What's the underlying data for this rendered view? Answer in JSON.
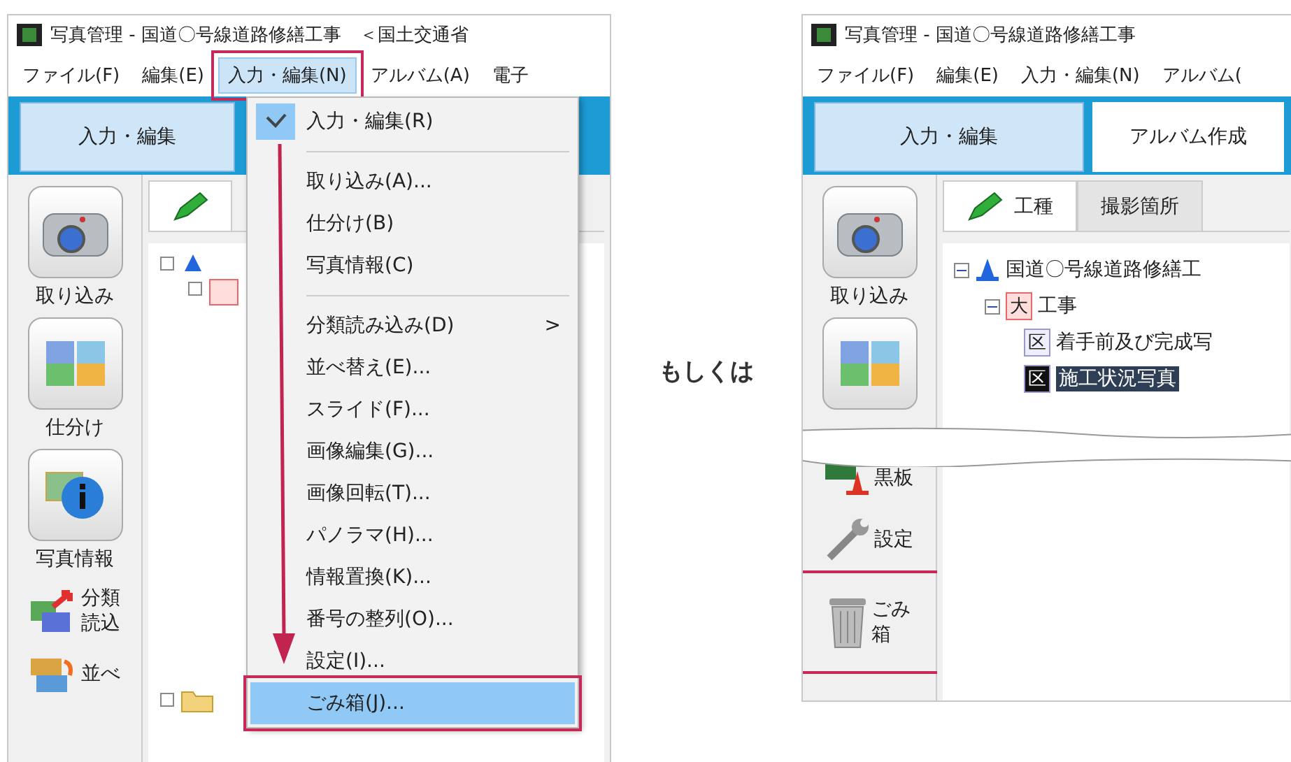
{
  "left_window": {
    "title": "写真管理 - 国道〇号線道路修繕工事　＜国土交通省",
    "menu": [
      {
        "label": "ファイル(F)",
        "selected": false,
        "annotated": false
      },
      {
        "label": "編集(E)",
        "selected": false,
        "annotated": false
      },
      {
        "label": "入力・編集(N)",
        "selected": true,
        "annotated": true
      },
      {
        "label": "アルバム(A)",
        "selected": false,
        "annotated": false
      },
      {
        "label": "電子",
        "selected": false,
        "annotated": false
      }
    ],
    "mode_tabs": [
      {
        "label": "入力・編集",
        "selected": true
      }
    ],
    "tools": [
      {
        "kind": "camera",
        "label": "取り込み"
      },
      {
        "kind": "sort",
        "label": "仕分け"
      },
      {
        "kind": "info",
        "label": "写真情報"
      },
      {
        "kind": "classify",
        "label": "分類読込"
      },
      {
        "kind": "reorder",
        "label": "並べ"
      }
    ],
    "dropdown": [
      {
        "kind": "item",
        "label": "入力・編集(R)",
        "checked": true,
        "selected": false,
        "annotated": false
      },
      {
        "kind": "separator"
      },
      {
        "kind": "item",
        "label": "取り込み(A)...",
        "checked": false,
        "selected": false,
        "annotated": false
      },
      {
        "kind": "item",
        "label": "仕分け(B)",
        "checked": false,
        "selected": false,
        "annotated": false
      },
      {
        "kind": "item",
        "label": "写真情報(C)",
        "checked": false,
        "selected": false,
        "annotated": false
      },
      {
        "kind": "separator"
      },
      {
        "kind": "submenu",
        "label": "分類読み込み(D)",
        "arrow": ">",
        "checked": false,
        "selected": false,
        "annotated": false
      },
      {
        "kind": "item",
        "label": "並べ替え(E)...",
        "checked": false,
        "selected": false,
        "annotated": false
      },
      {
        "kind": "item",
        "label": "スライド(F)...",
        "checked": false,
        "selected": false,
        "annotated": false
      },
      {
        "kind": "item",
        "label": "画像編集(G)...",
        "checked": false,
        "selected": false,
        "annotated": false
      },
      {
        "kind": "item",
        "label": "画像回転(T)...",
        "checked": false,
        "selected": false,
        "annotated": false
      },
      {
        "kind": "item",
        "label": "パノラマ(H)...",
        "checked": false,
        "selected": false,
        "annotated": false
      },
      {
        "kind": "item",
        "label": "情報置換(K)...",
        "checked": false,
        "selected": false,
        "annotated": false
      },
      {
        "kind": "item",
        "label": "番号の整列(O)...",
        "checked": false,
        "selected": false,
        "annotated": false
      },
      {
        "kind": "item",
        "label": "設定(I)...",
        "checked": false,
        "selected": false,
        "annotated": false
      },
      {
        "kind": "item",
        "label": "ごみ箱(J)...",
        "checked": false,
        "selected": true,
        "annotated": true
      }
    ]
  },
  "connector_text": "もしくは",
  "right_window": {
    "title": "写真管理 - 国道〇号線道路修繕工事",
    "menu": [
      {
        "label": "ファイル(F)",
        "selected": false,
        "annotated": false
      },
      {
        "label": "編集(E)",
        "selected": false,
        "annotated": false
      },
      {
        "label": "入力・編集(N)",
        "selected": false,
        "annotated": false
      },
      {
        "label": "アルバム(",
        "selected": false,
        "annotated": false
      }
    ],
    "mode_tabs": [
      {
        "label": "入力・編集",
        "selected": true
      },
      {
        "label": "アルバム作成",
        "selected": false
      }
    ],
    "panel_tabs": [
      {
        "kind": "pencil",
        "label": "工種",
        "selected": true
      },
      {
        "label": "撮影箇所",
        "selected": false
      }
    ],
    "tree": [
      {
        "kind": "project",
        "label": "国道〇号線道路修繕工",
        "expanded": true,
        "children": [
          {
            "kind": "major",
            "badge": "大",
            "label": "工事",
            "expanded": true,
            "children": [
              {
                "kind": "section",
                "badge": "区",
                "label": "着手前及び完成写",
                "selected": false
              },
              {
                "kind": "section",
                "badge": "区",
                "label": "施工状況写真",
                "selected": true
              }
            ]
          }
        ]
      }
    ],
    "tools": [
      {
        "kind": "camera",
        "label": "取り込み",
        "annotated": false
      },
      {
        "kind": "sort",
        "annotated": false
      },
      {
        "kind": "board",
        "label": "黒板",
        "annotated": false
      },
      {
        "kind": "wrench",
        "label": "設定",
        "annotated": false
      },
      {
        "kind": "trash",
        "label": "ごみ箱",
        "annotated": true
      }
    ]
  }
}
